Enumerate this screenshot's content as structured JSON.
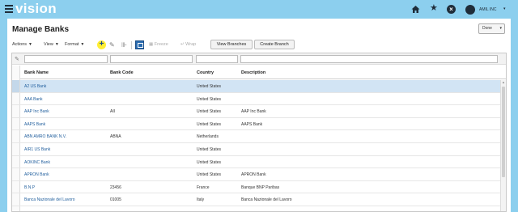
{
  "header": {
    "brand": "vision",
    "user_name": "AMIL INC",
    "icons": [
      "menu-icon",
      "home-icon",
      "star-icon",
      "close-icon",
      "user-icon"
    ]
  },
  "page": {
    "title": "Manage Banks",
    "done_label": "Done"
  },
  "toolbar": {
    "actions_label": "Actions",
    "view_label": "View",
    "format_label": "Format",
    "freeze_label": "Freeze",
    "wrap_label": "Wrap",
    "view_branches_label": "View Branches",
    "create_branch_label": "Create Branch"
  },
  "table": {
    "columns": [
      "Bank Name",
      "Bank Code",
      "Country",
      "Description"
    ],
    "rows": [
      {
        "name": "A2 US Bank",
        "code": "",
        "country": "United States",
        "description": ""
      },
      {
        "name": "AAA Bank",
        "code": "",
        "country": "United States",
        "description": ""
      },
      {
        "name": "AAP Inc Bank",
        "code": "AII",
        "country": "United States",
        "description": "AAP Inc Bank"
      },
      {
        "name": "AAPS Bank",
        "code": "",
        "country": "United States",
        "description": "AAPS Bank"
      },
      {
        "name": "ABN AMRO BANK N.V.",
        "code": "ABNA",
        "country": "Netherlands",
        "description": ""
      },
      {
        "name": "AIR1 US Bank",
        "code": "",
        "country": "United States",
        "description": ""
      },
      {
        "name": "AOKINC Bank",
        "code": "",
        "country": "United States",
        "description": ""
      },
      {
        "name": "APRON Bank",
        "code": "",
        "country": "United States",
        "description": "APRON Bank"
      },
      {
        "name": "B.N.P",
        "code": "23456",
        "country": "France",
        "description": "Banque BNP Paribas"
      },
      {
        "name": "Banca Nazionale del Lavoro",
        "code": "01005",
        "country": "Italy",
        "description": "Banca Nazionale del Lavoro"
      }
    ]
  },
  "colors": {
    "header_bg": "#8ccfee",
    "selected_row": "#d2e4f4",
    "link": "#1f5d9c",
    "add_button": "#ffee33"
  }
}
